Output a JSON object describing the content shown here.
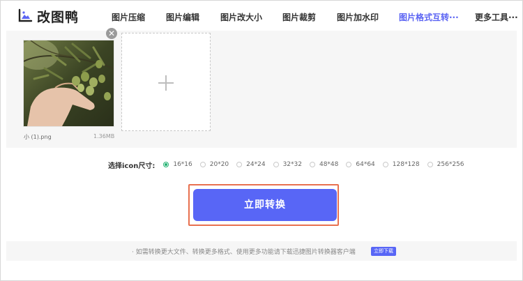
{
  "app": {
    "logo_text": "改图鸭"
  },
  "nav": {
    "items": [
      {
        "label": "图片压缩"
      },
      {
        "label": "图片编辑"
      },
      {
        "label": "图片改大小"
      },
      {
        "label": "图片裁剪"
      },
      {
        "label": "图片加水印"
      },
      {
        "label": "图片格式互转···",
        "active": true
      },
      {
        "label": "更多工具···"
      }
    ]
  },
  "upload": {
    "file": {
      "name": "小 (1).png",
      "size": "1.36MB"
    },
    "close_symbol": "✕"
  },
  "size_select": {
    "label": "选择icon尺寸:",
    "selected": "16*16",
    "options": [
      "16*16",
      "20*20",
      "24*24",
      "32*32",
      "48*48",
      "64*64",
      "128*128",
      "256*256"
    ]
  },
  "convert": {
    "button_label": "立即转换",
    "highlight_color": "#e8704f",
    "button_color": "#5866f6"
  },
  "footer": {
    "notice": "· 如需转换更大文件、转换更多格式、使用更多功能请下载迅捷图片转换器客户端",
    "download_label": "立即下载"
  },
  "colors": {
    "accent": "#5a63f3",
    "radio_checked": "#1fb16f"
  }
}
